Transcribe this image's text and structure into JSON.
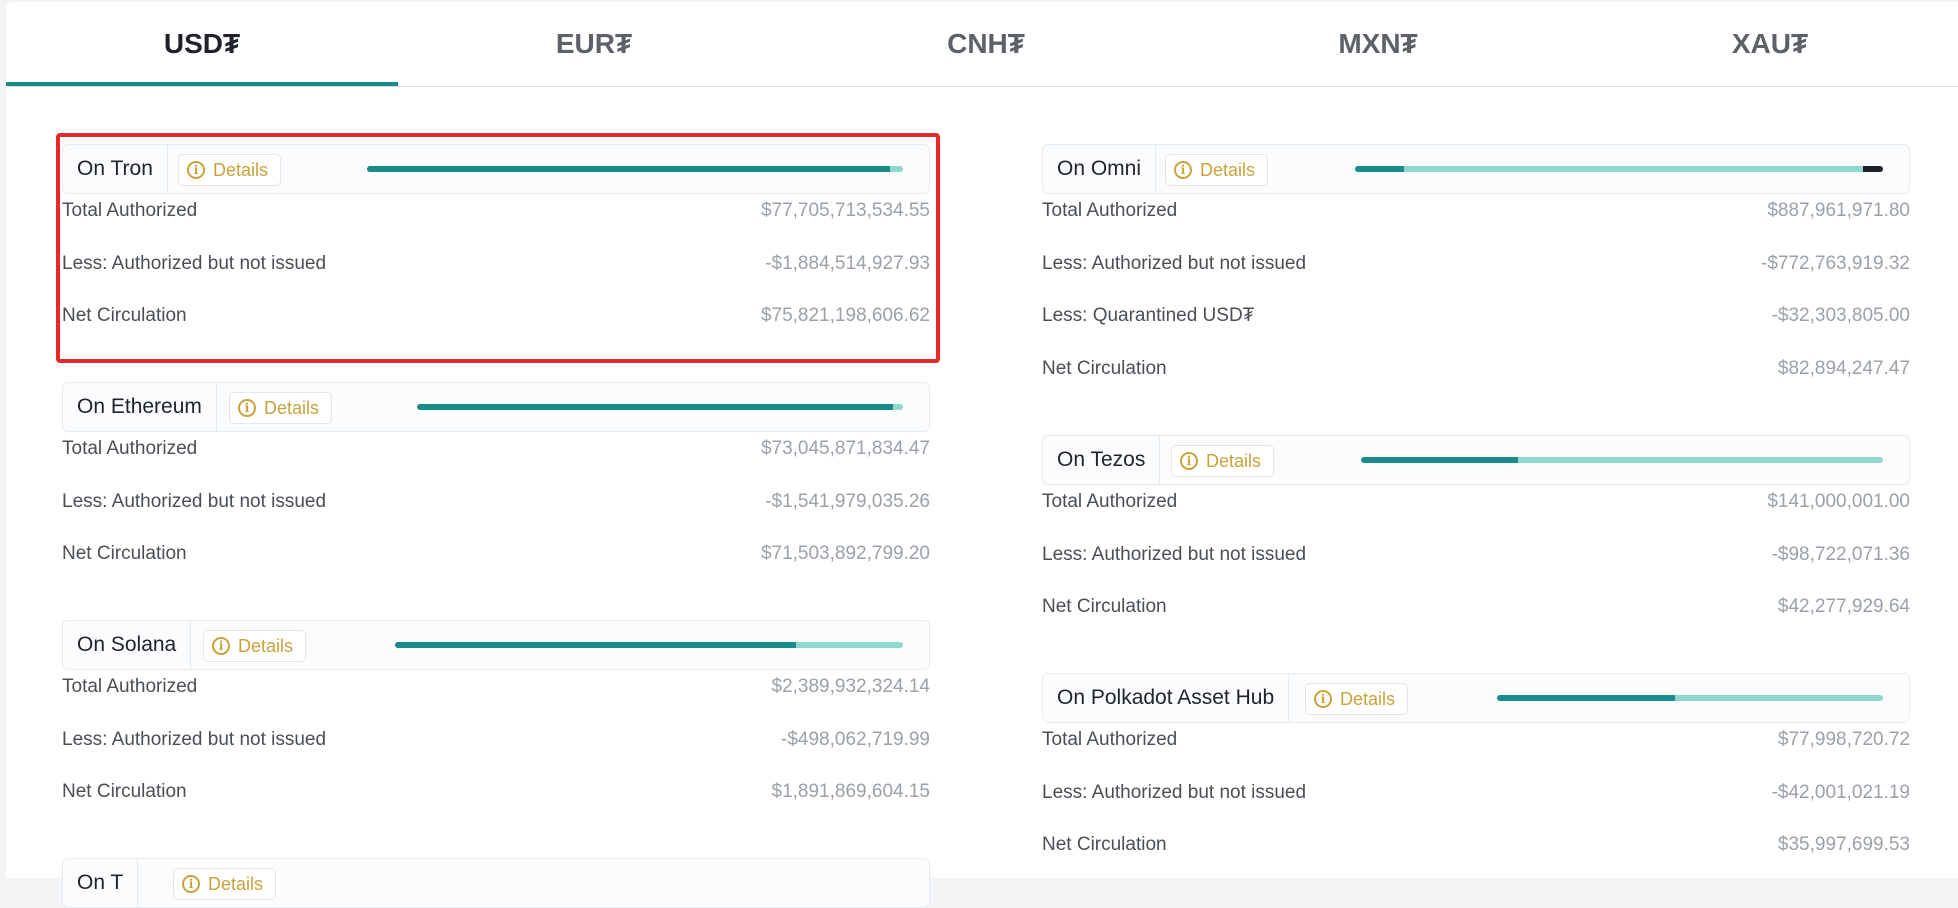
{
  "tabs": [
    {
      "label": "USD₮",
      "active": true
    },
    {
      "label": "EUR₮",
      "active": false
    },
    {
      "label": "CNH₮",
      "active": false
    },
    {
      "label": "MXN₮",
      "active": false
    },
    {
      "label": "XAU₮",
      "active": false
    }
  ],
  "details_label": "Details",
  "colors": {
    "accent": "#1a8b8c",
    "light": "#8fd8ce",
    "dark": "#1f2329",
    "details": "#c9a23b",
    "highlight": "#e8292a"
  },
  "left": [
    {
      "name": "On Tron",
      "bar_fractions": [
        0.976,
        0.024,
        0
      ],
      "rows": [
        {
          "label": "Total Authorized",
          "value": "$77,705,713,534.55"
        },
        {
          "label": "Less: Authorized but not issued",
          "value": "-$1,884,514,927.93"
        },
        {
          "label": "Net Circulation",
          "value": "$75,821,198,606.62"
        }
      ]
    },
    {
      "name": "On Ethereum",
      "bar_fractions": [
        0.979,
        0.021,
        0
      ],
      "rows": [
        {
          "label": "Total Authorized",
          "value": "$73,045,871,834.47"
        },
        {
          "label": "Less: Authorized but not issued",
          "value": "-$1,541,979,035.26"
        },
        {
          "label": "Net Circulation",
          "value": "$71,503,892,799.20"
        }
      ]
    },
    {
      "name": "On Solana",
      "bar_fractions": [
        0.79,
        0.21,
        0
      ],
      "rows": [
        {
          "label": "Total Authorized",
          "value": "$2,389,932,324.14"
        },
        {
          "label": "Less: Authorized but not issued",
          "value": "-$498,062,719.99"
        },
        {
          "label": "Net Circulation",
          "value": "$1,891,869,604.15"
        }
      ]
    },
    {
      "name": "On T",
      "bar_fractions": [
        0,
        0,
        0
      ],
      "rows": []
    }
  ],
  "right": [
    {
      "name": "On Omni",
      "bar_fractions": [
        0.093,
        0.87,
        0.037
      ],
      "rows": [
        {
          "label": "Total Authorized",
          "value": "$887,961,971.80"
        },
        {
          "label": "Less: Authorized but not issued",
          "value": "-$772,763,919.32"
        },
        {
          "label": "Less: Quarantined USD₮",
          "value": "-$32,303,805.00"
        },
        {
          "label": "Net Circulation",
          "value": "$82,894,247.47"
        }
      ]
    },
    {
      "name": "On Tezos",
      "bar_fractions": [
        0.3,
        0.7,
        0
      ],
      "rows": [
        {
          "label": "Total Authorized",
          "value": "$141,000,001.00"
        },
        {
          "label": "Less: Authorized but not issued",
          "value": "-$98,722,071.36"
        },
        {
          "label": "Net Circulation",
          "value": "$42,277,929.64"
        }
      ]
    },
    {
      "name": "On Polkadot Asset Hub",
      "bar_fractions": [
        0.46,
        0.54,
        0
      ],
      "rows": [
        {
          "label": "Total Authorized",
          "value": "$77,998,720.72"
        },
        {
          "label": "Less: Authorized but not issued",
          "value": "-$42,001,021.19"
        },
        {
          "label": "Net Circulation",
          "value": "$35,997,699.53"
        }
      ]
    }
  ]
}
